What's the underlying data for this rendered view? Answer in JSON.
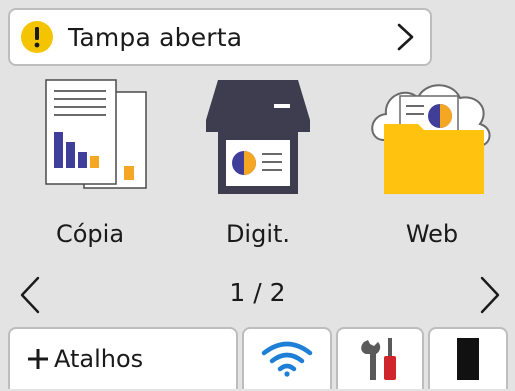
{
  "status": {
    "message": "Tampa aberta",
    "icon": "warning-icon",
    "warning_color": "#f5c400"
  },
  "apps": [
    {
      "label": "Cópia",
      "icon": "copy-icon"
    },
    {
      "label": "Digit.",
      "icon": "scan-icon"
    },
    {
      "label": "Web",
      "icon": "web-icon"
    }
  ],
  "pager": {
    "indicator": "1 / 2"
  },
  "bottom_bar": {
    "shortcuts_label": "Atalhos",
    "wifi_icon": "wifi-icon",
    "tools_icon": "tools-icon",
    "ink_icon": "ink-level-icon"
  },
  "colors": {
    "accent_blue": "#1e7fd6",
    "folder_yellow": "#ffc20e",
    "chart_blue": "#3f3f9a",
    "chart_orange": "#f5a623"
  }
}
